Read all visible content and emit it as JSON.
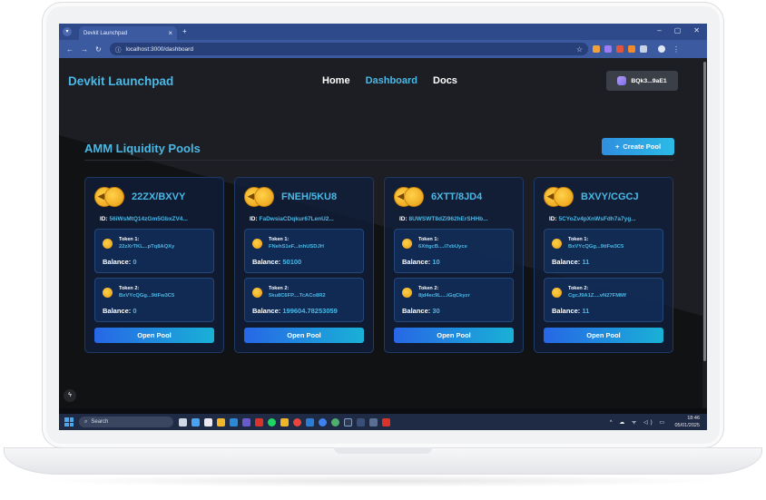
{
  "browser": {
    "tab_title": "Devkit Launchpad",
    "tab_close": "×",
    "new_tab": "+",
    "url": "localhost:3000/dashboard",
    "window_controls": [
      "–",
      "▢",
      "✕"
    ]
  },
  "app": {
    "brand": "Devkit Launchpad",
    "nav": {
      "home": "Home",
      "dashboard": "Dashboard",
      "docs": "Docs"
    },
    "wallet": "BQk3...9aE1",
    "section_title": "AMM Liquidity Pools",
    "create_button": "Create Pool",
    "create_button_icon": "+",
    "id_label": "ID:",
    "balance_label": "Balance:",
    "open_button": "Open Pool",
    "pools": [
      {
        "pair": "22ZX/BXVY",
        "id": "56iWsMtQ14zGm5GbxZV4...",
        "token1": {
          "label": "Token 1:",
          "address": "22zXrTKL...pTq8AQXy",
          "balance": "0"
        },
        "token2": {
          "label": "Token 2:",
          "address": "BxVYcQGg...9tiFw3C5",
          "balance": "0"
        }
      },
      {
        "pair": "FNEH/5KU8",
        "id": "FaDwsiaCDqkur67LenU2...",
        "token1": {
          "label": "Token 1:",
          "address": "FNehS1eF...inhUSDJH",
          "balance": "50100"
        },
        "token2": {
          "label": "Token 2:",
          "address": "5ku8C6FP....TcACo8R2",
          "balance": "199604.78253059"
        }
      },
      {
        "pair": "6XTT/8JD4",
        "id": "8UWSWT8dZi962hErSHHb...",
        "token1": {
          "label": "Token 1:",
          "address": "6XttgcB....i7xbUyce",
          "balance": "10"
        },
        "token2": {
          "label": "Token 2:",
          "address": "8jd4ec9L....iGqCkyzr",
          "balance": "30"
        }
      },
      {
        "pair": "BXVY/CGCJ",
        "id": "5CYoZv4pXnWsFdh7a7yg...",
        "token1": {
          "label": "Token 1:",
          "address": "BxVYcQGg...9tiFw3C5",
          "balance": "11"
        },
        "token2": {
          "label": "Token 2:",
          "address": "CgcJ9A1Z....vN27FMMf",
          "balance": "11"
        }
      }
    ]
  },
  "taskbar": {
    "search_placeholder": "Search",
    "time": "18:46",
    "date": "05/01/2025"
  },
  "colors": {
    "accent": "#4ab8e6",
    "browser_chrome": "#3c5aa0",
    "card_bg": "#101e3a",
    "button_gradient_start": "#2767e6",
    "button_gradient_end": "#19b1d6"
  }
}
